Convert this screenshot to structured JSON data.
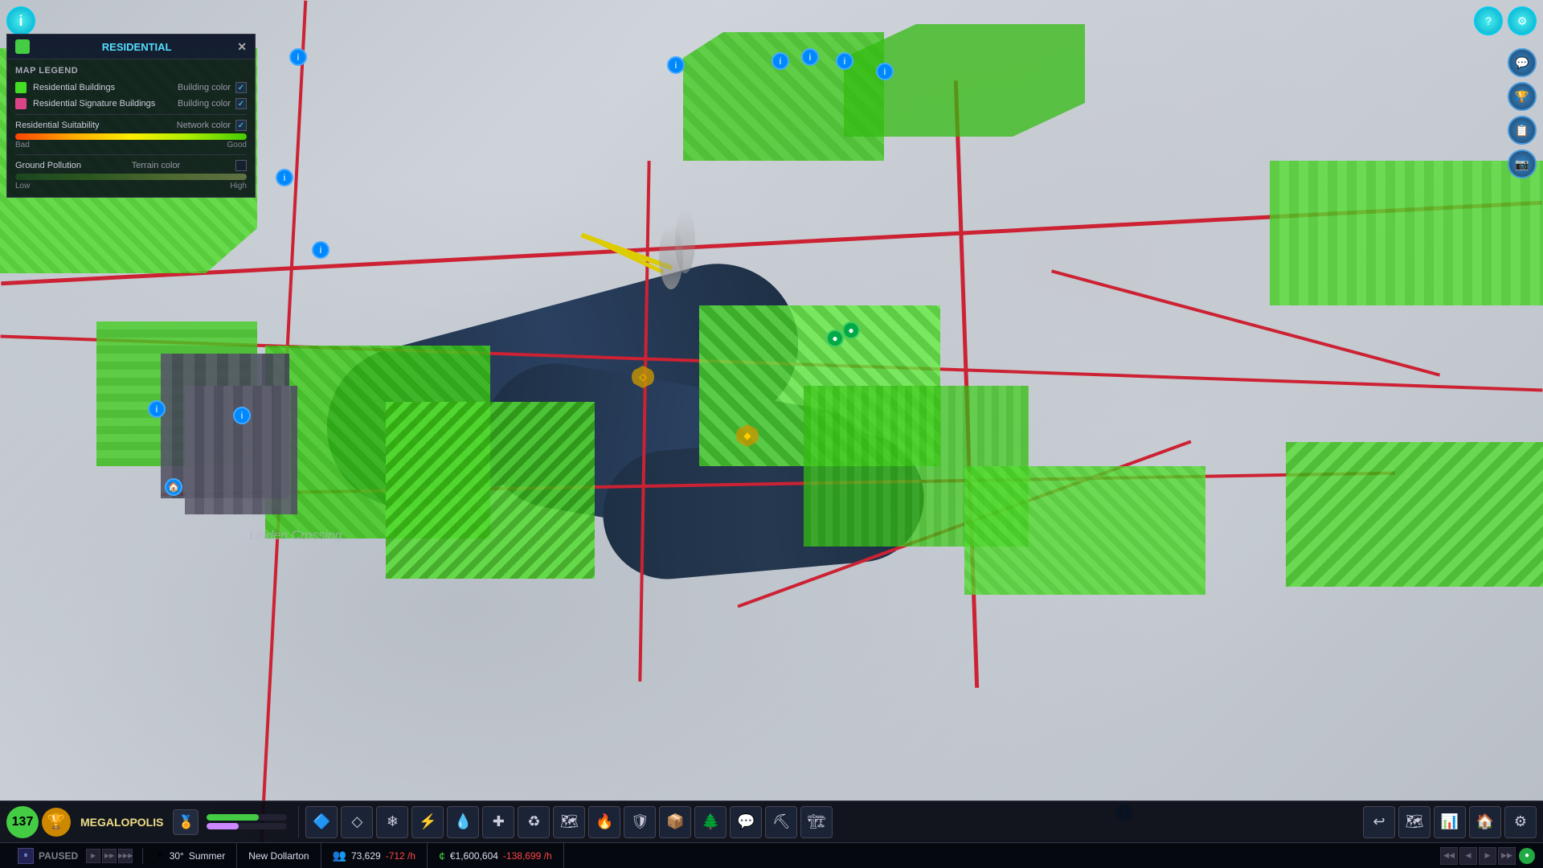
{
  "topLeft": {
    "infoLabel": "i"
  },
  "topRight": {
    "helpLabel": "?",
    "settingsLabel": "⚙"
  },
  "legendPanel": {
    "title": "RESIDENTIAL",
    "iconColor": "#44cc44",
    "closeLabel": "✕",
    "mapLegendLabel": "MAP LEGEND",
    "items": [
      {
        "colorBox": "#44dd22",
        "label": "Residential Buildings",
        "colorType": "Building color",
        "checked": true
      },
      {
        "colorBox": "#dd4488",
        "label": "Residential Signature Buildings",
        "colorType": "Building color",
        "checked": true
      }
    ],
    "suitability": {
      "label": "Residential Suitability",
      "colorType": "Network color",
      "checked": true,
      "badLabel": "Bad",
      "goodLabel": "Good",
      "gradientColors": "linear-gradient(to right, #ff4400, #ffaa00, #ffee00, #aaee00, #44cc00)"
    },
    "pollution": {
      "label": "Ground Pollution",
      "colorType": "Terrain color",
      "checked": false,
      "lowLabel": "Low",
      "highLabel": "High",
      "gradientColors": "linear-gradient(to right, #226622, #448822, #88aa44, #aabb66)"
    }
  },
  "mapCity": {
    "name": "Linden Crossing"
  },
  "toolbar": {
    "cityLevel": "137",
    "cityName": "MEGALOPOLIS",
    "progressBar1Color": "#44cc44",
    "progressBar1Pct": 65,
    "progressBar2Color": "#cc88ff",
    "progressBar2Pct": 40,
    "buttons": [
      {
        "icon": "🔷",
        "label": "zones"
      },
      {
        "icon": "◇",
        "label": "districts"
      },
      {
        "icon": "❄",
        "label": "services"
      },
      {
        "icon": "⚡",
        "label": "electricity"
      },
      {
        "icon": "💧",
        "label": "water"
      },
      {
        "icon": "✝",
        "label": "healthcare"
      },
      {
        "icon": "♻",
        "label": "garbage"
      },
      {
        "icon": "🗺",
        "label": "map"
      },
      {
        "icon": "🔥",
        "label": "fire"
      },
      {
        "icon": "🛡",
        "label": "police"
      },
      {
        "icon": "📦",
        "label": "cargo"
      },
      {
        "icon": "🌲",
        "label": "parks"
      },
      {
        "icon": "💬",
        "label": "social"
      },
      {
        "icon": "⛏",
        "label": "mining"
      },
      {
        "icon": "🏗",
        "label": "bulldoze"
      }
    ],
    "rightButtons": [
      {
        "icon": "🔄",
        "label": "undo"
      },
      {
        "icon": "🗺",
        "label": "minimap"
      },
      {
        "icon": "📊",
        "label": "stats"
      },
      {
        "icon": "🏠",
        "label": "housing"
      },
      {
        "icon": "⚙",
        "label": "settings2"
      }
    ]
  },
  "statusBar": {
    "pauseIcon": "⏸",
    "pausedLabel": "PAUSED",
    "speedButtons": [
      "▶",
      "▶▶",
      "▶▶▶"
    ],
    "weatherIcon": "☀",
    "temperature": "30°",
    "season": "Summer",
    "cityNameLabel": "New Dollarton",
    "populationIcon": "👥",
    "population": "73,629",
    "populationChange": "-712 /h",
    "moneyIcon": "¢",
    "balance": "€1,600,604",
    "balanceChange": "-138,699 /h",
    "onlineIcon": "●"
  }
}
